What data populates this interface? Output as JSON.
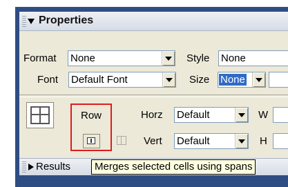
{
  "properties_panel": {
    "title": "Properties",
    "format_label": "Format",
    "format_value": "None",
    "style_label": "Style",
    "style_value": "None",
    "font_label": "Font",
    "font_value": "Default Font",
    "size_label": "Size",
    "size_value": "None",
    "row_label": "Row",
    "horz_label": "Horz",
    "horz_value": "Default",
    "vert_label": "Vert",
    "vert_value": "Default",
    "w_label": "W",
    "h_label": "H"
  },
  "results_panel": {
    "title": "Results"
  },
  "tooltip": {
    "text": "Merges selected cells using spans"
  },
  "colors": {
    "frame": "#2e4d82",
    "panel": "#ece9d8",
    "highlight_box": "#e01b1b",
    "selection": "#316ac5",
    "tooltip_bg": "#ffffe1"
  },
  "icons": [
    "grip-icon",
    "collapse-triangle-icon",
    "expand-triangle-icon",
    "table-cell-icon",
    "merge-cells-icon",
    "split-cells-icon",
    "dropdown-arrow-icon"
  ]
}
